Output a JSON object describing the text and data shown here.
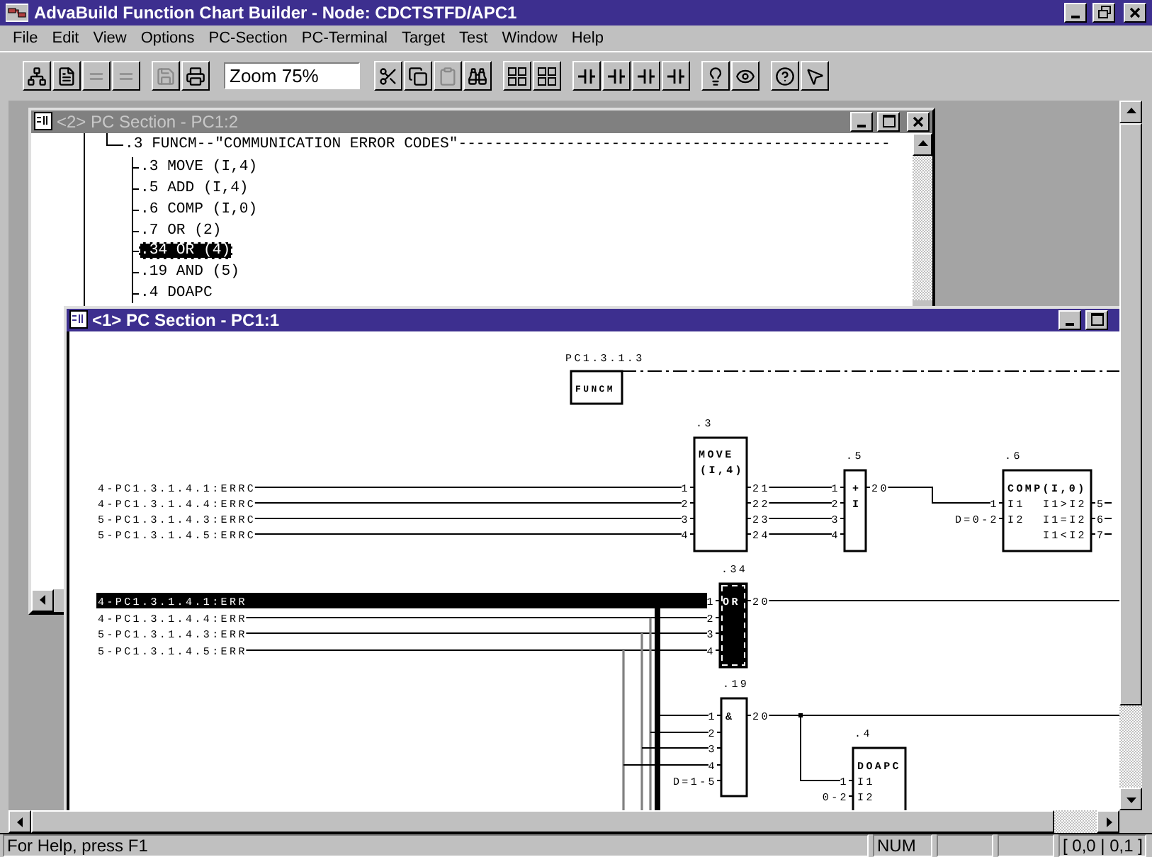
{
  "app": {
    "title": "AdvaBuild Function Chart Builder - Node: CDCTSTFD/APC1"
  },
  "menu": [
    "File",
    "Edit",
    "View",
    "Options",
    "PC-Section",
    "PC-Terminal",
    "Target",
    "Test",
    "Window",
    "Help"
  ],
  "toolbar": {
    "zoom": "Zoom 75%",
    "tools": [
      {
        "disabled": false
      },
      {
        "disabled": false
      },
      {
        "disabled": true
      },
      {
        "disabled": true
      },
      {
        "disabled": true
      },
      {
        "disabled": false
      },
      {
        "disabled": false
      },
      {
        "disabled": false
      },
      {
        "disabled": true
      },
      {
        "disabled": false
      },
      {
        "disabled": false
      },
      {
        "disabled": false
      },
      {
        "disabled": false
      },
      {
        "disabled": false
      },
      {
        "disabled": false
      },
      {
        "disabled": false
      },
      {
        "disabled": false
      },
      {
        "disabled": false
      },
      {
        "disabled": false
      },
      {
        "disabled": false
      }
    ]
  },
  "windows": [
    {
      "title": "<2> PC Section - PC1:2",
      "active": false,
      "tree": [
        {
          "label": ".3 FUNCM--\"COMMUNICATION ERROR CODES\"------------------------------------------------",
          "selected": false,
          "children": [
            {
              "label": ".3 MOVE (I,4)",
              "selected": false
            },
            {
              "label": ".5 ADD (I,4)",
              "selected": false
            },
            {
              "label": ".6 COMP (I,0)",
              "selected": false
            },
            {
              "label": ".7 OR (2)",
              "selected": false
            },
            {
              "label": ".34 OR (4)",
              "selected": true
            },
            {
              "label": ".19 AND (5)",
              "selected": false
            },
            {
              "label": ".4 DOAPC",
              "selected": false
            }
          ]
        }
      ]
    },
    {
      "title": "<1> PC Section - PC1:1",
      "active": true,
      "chart": {
        "section": "PC1.3.1.3",
        "section_block": "FUNCM",
        "signal_groups": [
          {
            "signals": [
              {
                "text": "4-PC1.3.1.4.1:ERRC",
                "selected": false
              },
              {
                "text": "4-PC1.3.1.4.4:ERRC",
                "selected": false
              },
              {
                "text": "5-PC1.3.1.4.3:ERRC",
                "selected": false
              },
              {
                "text": "5-PC1.3.1.4.5:ERRC",
                "selected": false
              }
            ]
          },
          {
            "signals": [
              {
                "text": "4-PC1.3.1.4.1:ERR",
                "selected": true
              },
              {
                "text": "4-PC1.3.1.4.4:ERR",
                "selected": false
              },
              {
                "text": "5-PC1.3.1.4.3:ERR",
                "selected": false
              },
              {
                "text": "5-PC1.3.1.4.5:ERR",
                "selected": false
              }
            ]
          }
        ],
        "blocks": [
          {
            "kind": "move",
            "number": ".3",
            "lines": [
              "MOVE",
              "(I,4)"
            ],
            "inputs": [
              "1",
              "2",
              "3",
              "4"
            ],
            "outputs": [
              "21",
              "22",
              "23",
              "24"
            ],
            "selected": false
          },
          {
            "kind": "add",
            "number": ".5",
            "lines": [
              "+",
              "I"
            ],
            "inputs": [
              "1",
              "2",
              "3",
              "4"
            ],
            "outputs": [
              "20"
            ],
            "selected": false
          },
          {
            "kind": "comp",
            "number": ".6",
            "lines": [
              "COMP(I,0)"
            ],
            "inputs": [
              "1",
              "D=0-2"
            ],
            "input_names": [
              "I1",
              "I2"
            ],
            "output_names": [
              "I1>I2",
              "I1=I2",
              "I1<I2"
            ],
            "outputs": [
              "5",
              "6",
              "7"
            ],
            "selected": false
          },
          {
            "kind": "or",
            "number": ".34",
            "lines": [
              "OR"
            ],
            "inputs": [
              "1",
              "2",
              "3",
              "4"
            ],
            "outputs": [
              "20"
            ],
            "selected": true
          },
          {
            "kind": "and",
            "number": ".19",
            "lines": [
              "&"
            ],
            "inputs": [
              "1",
              "2",
              "3",
              "4",
              "D=1-5"
            ],
            "outputs": [
              "20"
            ],
            "selected": false
          },
          {
            "kind": "doapc",
            "number": ".4",
            "lines": [
              "DOAPC"
            ],
            "inputs": [
              "1",
              "0-2"
            ],
            "input_names": [
              "I1",
              "I2"
            ],
            "selected": false
          }
        ]
      }
    }
  ],
  "status": {
    "help": "For Help, press F1",
    "num": "NUM",
    "position": "[ 0,0 | 0,1 ]"
  }
}
